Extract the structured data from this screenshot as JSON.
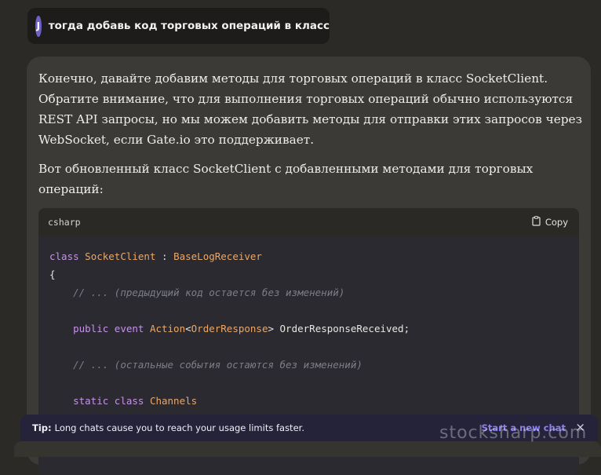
{
  "user_message": {
    "avatar_initial": "J",
    "text": "тогда добавь код торговых операций в класс"
  },
  "assistant": {
    "paragraph1": [
      "Конечно, давайте добавим методы для торговых операций в класс SocketClient.",
      "Обратите внимание, что для выполнения торговых операций обычно используются",
      "REST API запросы, но мы можем добавить методы для отправки этих запросов через",
      "WebSocket, если Gate.io это поддерживает."
    ],
    "paragraph2": [
      "Вот обновленный класс SocketClient с добавленными методами для торговых",
      "операций:"
    ]
  },
  "code_block": {
    "language": "csharp",
    "copy_label": "Copy",
    "copy_icon": "clipboard-icon",
    "lines": {
      "l1_kw": "class",
      "l1_name": "SocketClient",
      "l1_sep": " : ",
      "l1_base": "BaseLogReceiver",
      "l2": "{",
      "l3": "// ... (предыдущий код остается без изменений)",
      "l5_kw": "public event",
      "l5_type": "Action",
      "l5_lt": "<",
      "l5_arg": "OrderResponse",
      "l5_rest": "> OrderResponseReceived;",
      "l7": "// ... (остальные события остаются без изменений)",
      "l9_kw": "static class",
      "l9_name": "Channels",
      "l10": "{"
    }
  },
  "tip_bar": {
    "label": "Tip:",
    "text": "Long chats cause you to reach your usage limits faster.",
    "link": "Start a new chat",
    "close": "×"
  },
  "watermark": "stocksharp.com",
  "colors": {
    "background": "#2b2a27",
    "card": "#3b3a37",
    "avatar": "#6f62c4",
    "keyword": "#c792ea",
    "type": "#e9a86a",
    "comment": "#7d7f86",
    "tip_link": "#8b7ff0"
  }
}
